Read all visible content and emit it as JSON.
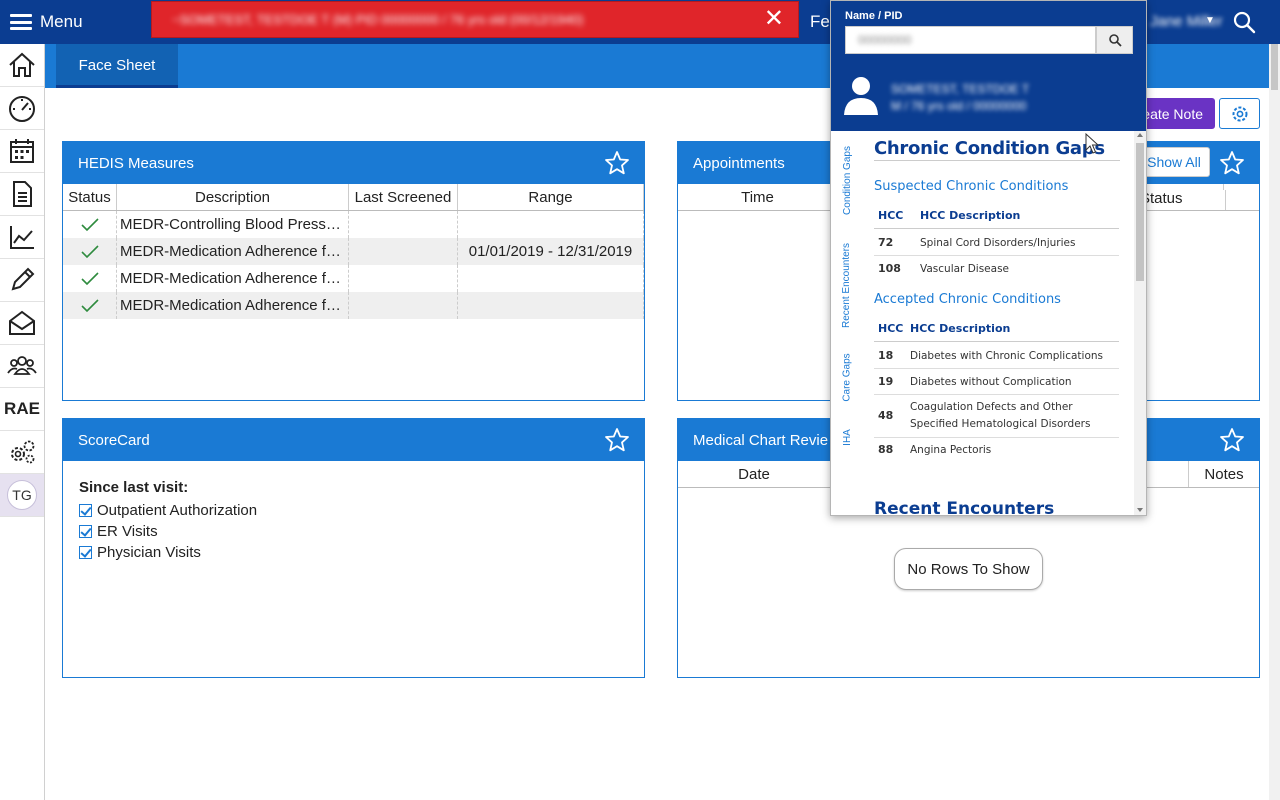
{
  "topbar": {
    "menu_label": "Menu",
    "patient_banner": "~SOMETEST, TESTDOE T (M) PID 00000000 / 76 yrs old (00/12/1940)",
    "feature_text": "Fe",
    "user_name": "Jane Miller",
    "colors": {
      "bar": "#0b3d91",
      "banner": "#e0252a"
    }
  },
  "sidebar": {
    "items": [
      {
        "icon": "home-icon"
      },
      {
        "icon": "dashboard-icon"
      },
      {
        "icon": "calendar-icon"
      },
      {
        "icon": "document-icon"
      },
      {
        "icon": "chart-icon"
      },
      {
        "icon": "pencil-icon"
      },
      {
        "icon": "mail-icon"
      },
      {
        "icon": "group-icon"
      },
      {
        "label": "RAE"
      },
      {
        "icon": "settings-icon"
      },
      {
        "label": "TG"
      }
    ]
  },
  "tabs": {
    "active": "Face Sheet"
  },
  "actions": {
    "create_note": "eate Note"
  },
  "hedis": {
    "title": "HEDIS Measures",
    "columns": [
      "Status",
      "Description",
      "Last Screened",
      "Range"
    ],
    "rows": [
      {
        "description": "MEDR-Controlling Blood Press…",
        "last_screened": "",
        "range": ""
      },
      {
        "description": "MEDR-Medication Adherence f…",
        "last_screened": "",
        "range": "01/01/2019 - 12/31/2019"
      },
      {
        "description": "MEDR-Medication Adherence f…",
        "last_screened": "",
        "range": ""
      },
      {
        "description": "MEDR-Medication Adherence f…",
        "last_screened": "",
        "range": ""
      }
    ]
  },
  "appointments": {
    "title": "Appointments",
    "show_all": "Show All",
    "columns": [
      "Time",
      "Status"
    ]
  },
  "scorecard": {
    "title": "ScoreCard",
    "since_label": "Since last visit:",
    "items": [
      "Outpatient Authorization",
      "ER Visits",
      "Physician Visits"
    ]
  },
  "medical_chart": {
    "title": "Medical Chart Revie",
    "columns": [
      "Date",
      "Notes"
    ],
    "empty_text": "No Rows To Show"
  },
  "popup": {
    "search_label": "Name / PID",
    "search_value": "00000000",
    "patient_name": "SOMETEST, TESTDOE T",
    "patient_info": "M / 76 yrs old / 00000000",
    "vertical_tabs": [
      "Condition Gaps",
      "Recent Encounters",
      "Care Gaps",
      "IHA"
    ],
    "section_title": "Chronic Condition Gaps",
    "suspected": {
      "title": "Suspected Chronic Conditions",
      "col_hcc": "HCC",
      "col_desc": "HCC Description",
      "rows": [
        {
          "hcc": "72",
          "desc": "Spinal Cord Disorders/Injuries"
        },
        {
          "hcc": "108",
          "desc": "Vascular Disease"
        }
      ]
    },
    "accepted": {
      "title": "Accepted Chronic Conditions",
      "col_hcc": "HCC",
      "col_desc": "HCC Description",
      "rows": [
        {
          "hcc": "18",
          "desc": "Diabetes with Chronic Complications"
        },
        {
          "hcc": "19",
          "desc": "Diabetes without Complication"
        },
        {
          "hcc": "48",
          "desc": "Coagulation Defects and Other Specified Hematological Disorders"
        },
        {
          "hcc": "88",
          "desc": "Angina Pectoris"
        }
      ]
    },
    "next_section": "Recent Encounters"
  }
}
